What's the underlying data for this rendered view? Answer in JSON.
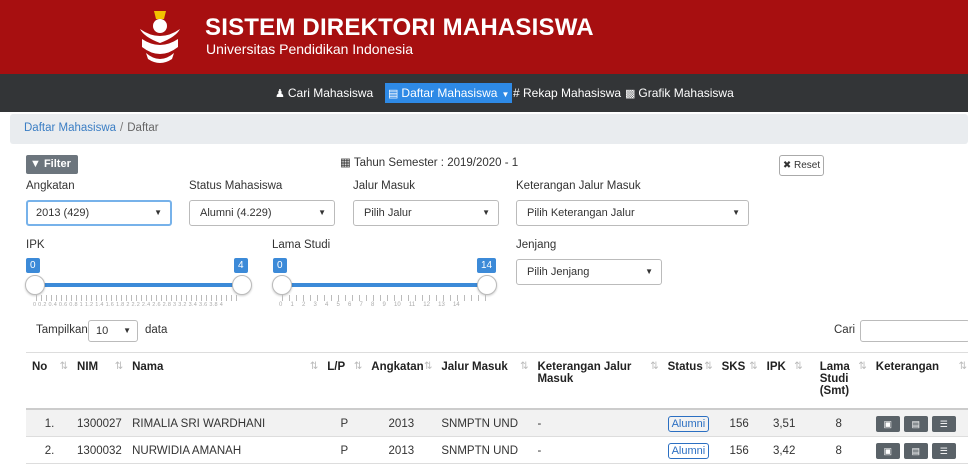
{
  "header": {
    "title": "SISTEM DIREKTORI MAHASISWA",
    "subtitle": "Universitas Pendidikan Indonesia",
    "bg_color": "#a70f10"
  },
  "nav": {
    "items": [
      {
        "icon": "users-icon",
        "label": "Cari Mahasiswa"
      },
      {
        "icon": "list-icon",
        "label": "Daftar Mahasiswa"
      },
      {
        "icon": "hash-icon",
        "label": "# Rekap Mahasiswa"
      },
      {
        "icon": "bar-chart-icon",
        "label": "Grafik Mahasiswa"
      }
    ],
    "active_color": "#2e8ae6"
  },
  "breadcrumb": {
    "link": "Daftar Mahasiswa",
    "current": "Daftar"
  },
  "filters": {
    "filter_label": "Filter",
    "semester": "Tahun Semester : 2019/2020 - 1",
    "reset_label": "Reset",
    "angkatan": {
      "label": "Angkatan",
      "value": "2013 (429)"
    },
    "status": {
      "label": "Status Mahasiswa",
      "value": "Alumni (4.229)"
    },
    "jalur": {
      "label": "Jalur Masuk",
      "value": "Pilih Jalur"
    },
    "keterangan": {
      "label": "Keterangan Jalur Masuk",
      "value": "Pilih Keterangan Jalur"
    },
    "ipk": {
      "label": "IPK",
      "min": "0",
      "max": "4",
      "ticks": "0 0.2 0.4 0.6 0.8 1 1.2 1.4 1.6 1.8 2 2.2 2.4 2.6 2.8 3 3.2 3.4 3.6 3.8 4"
    },
    "lama": {
      "label": "Lama Studi",
      "min": "0",
      "max": "14",
      "ticks": "0 1 2 3 4 5 6 7 8 9 10 11 12 13 14"
    },
    "jenjang": {
      "label": "Jenjang",
      "value": "Pilih Jenjang"
    }
  },
  "table_controls": {
    "show_label": "Tampilkan",
    "show_value": "10",
    "show_suffix": "data",
    "search_label": "Cari"
  },
  "table": {
    "headers": {
      "no": "No",
      "nim": "NIM",
      "nama": "Nama",
      "lp": "L/P",
      "angkatan": "Angkatan",
      "jalur": "Jalur Masuk",
      "ket_jalur": "Keterangan Jalur Masuk",
      "status": "Status",
      "sks": "SKS",
      "ipk": "IPK",
      "lama": "Lama Studi (Smt)",
      "keterangan": "Keterangan"
    },
    "rows": [
      {
        "no": "1.",
        "nim": "1300027",
        "nama": "RIMALIA SRI WARDHANI",
        "lp": "P",
        "angkatan": "2013",
        "jalur": "SNMPTN UND",
        "ket": "-",
        "status": "Alumni",
        "sks": "156",
        "ipk": "3,51",
        "lama": "8"
      },
      {
        "no": "2.",
        "nim": "1300032",
        "nama": "NURWIDIA AMANAH",
        "lp": "P",
        "angkatan": "2013",
        "jalur": "SNMPTN UND",
        "ket": "-",
        "status": "Alumni",
        "sks": "156",
        "ipk": "3,42",
        "lama": "8"
      }
    ]
  }
}
